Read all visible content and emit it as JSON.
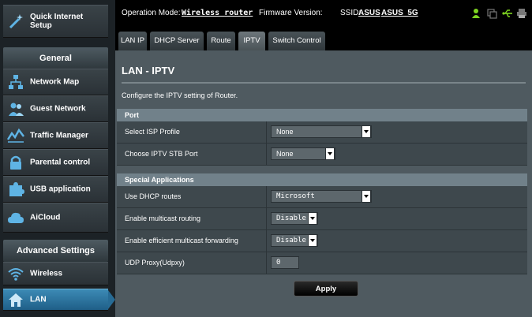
{
  "sidebar": {
    "quick_setup": "Quick Internet Setup",
    "general_header": "General",
    "general_items": [
      {
        "label": "Network Map",
        "icon": "network-map-icon"
      },
      {
        "label": "Guest Network",
        "icon": "guest-network-icon"
      },
      {
        "label": "Traffic Manager",
        "icon": "traffic-manager-icon"
      },
      {
        "label": "Parental control",
        "icon": "lock-icon"
      },
      {
        "label": "USB application",
        "icon": "puzzle-icon"
      },
      {
        "label": "AiCloud",
        "icon": "cloud-icon"
      }
    ],
    "advanced_header": "Advanced Settings",
    "advanced_items": [
      {
        "label": "Wireless",
        "icon": "wifi-icon"
      },
      {
        "label": "LAN",
        "icon": "home-icon",
        "active": true
      }
    ]
  },
  "topbar": {
    "mode_label": "Operation Mode:",
    "mode_value": "Wireless router",
    "firmware_label": "Firmware Version:",
    "ssid_label": "SSID:",
    "ssid_1": "ASUS",
    "ssid_2": "ASUS_5G",
    "icons": [
      "user-icon",
      "copy-icon",
      "usb-icon",
      "printer-icon"
    ],
    "accent": "#7ed321"
  },
  "tabs": [
    {
      "label": "LAN IP"
    },
    {
      "label": "DHCP Server"
    },
    {
      "label": "Route"
    },
    {
      "label": "IPTV",
      "active": true
    },
    {
      "label": "Switch Control"
    }
  ],
  "main": {
    "title": "LAN - IPTV",
    "description": "Configure the IPTV setting of Router.",
    "port_group": {
      "title": "Port",
      "rows": [
        {
          "label": "Select ISP Profile",
          "value": "None"
        },
        {
          "label": "Choose IPTV STB Port",
          "value": "None"
        }
      ]
    },
    "special_group": {
      "title": "Special Applications",
      "rows": [
        {
          "label": "Use DHCP routes",
          "value": "Microsoft"
        },
        {
          "label": "Enable multicast routing",
          "value": "Disable"
        },
        {
          "label": "Enable efficient multicast forwarding",
          "value": "Disable"
        },
        {
          "label": "UDP Proxy(Udpxy)",
          "value": "0"
        }
      ]
    },
    "apply_label": "Apply"
  }
}
